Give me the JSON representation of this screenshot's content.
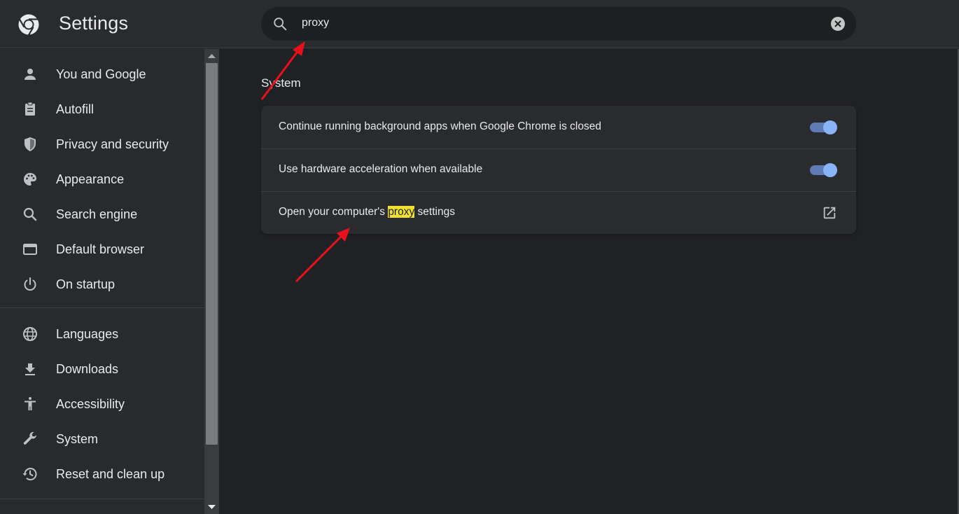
{
  "app": {
    "title": "Settings"
  },
  "search": {
    "value": "proxy"
  },
  "sidebar": {
    "items": [
      {
        "label": "You and Google",
        "icon": "person-icon"
      },
      {
        "label": "Autofill",
        "icon": "clipboard-icon"
      },
      {
        "label": "Privacy and security",
        "icon": "shield-icon"
      },
      {
        "label": "Appearance",
        "icon": "palette-icon"
      },
      {
        "label": "Search engine",
        "icon": "search-icon"
      },
      {
        "label": "Default browser",
        "icon": "browser-window-icon"
      },
      {
        "label": "On startup",
        "icon": "power-icon"
      },
      {
        "label": "Languages",
        "icon": "globe-icon"
      },
      {
        "label": "Downloads",
        "icon": "download-icon"
      },
      {
        "label": "Accessibility",
        "icon": "accessibility-icon"
      },
      {
        "label": "System",
        "icon": "wrench-icon"
      },
      {
        "label": "Reset and clean up",
        "icon": "history-icon"
      }
    ]
  },
  "main": {
    "section_title": "System",
    "rows": [
      {
        "label": "Continue running background apps when Google Chrome is closed",
        "toggle_on": true
      },
      {
        "label": "Use hardware acceleration when available",
        "toggle_on": true
      },
      {
        "label_before": "Open your computer's ",
        "label_highlight": "proxy",
        "label_after": " settings",
        "icon": "launch-icon"
      }
    ]
  },
  "colors": {
    "background": "#202124",
    "sidebar": "#292a2d",
    "accent": "#8ab4f8",
    "highlight": "#f2e02f",
    "annotation_arrow": "#e8101a"
  }
}
